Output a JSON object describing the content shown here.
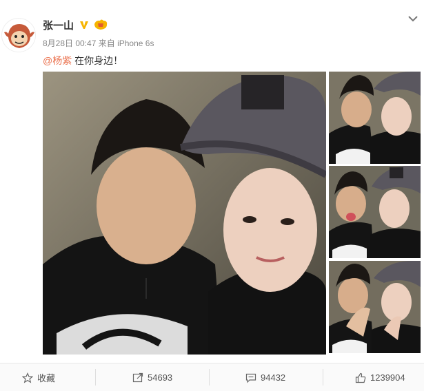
{
  "post": {
    "username": "张一山",
    "date": "8月28日 00:47",
    "source": "来自 iPhone 6s",
    "mention": "@杨紫",
    "text": " 在你身边！"
  },
  "actions": {
    "favorite": "收藏",
    "repost": "54693",
    "comment": "94432",
    "like": "1239904"
  },
  "colors": {
    "mention": "#eb7350",
    "vip_badge": "#f6b400",
    "meta_text": "#888888"
  }
}
